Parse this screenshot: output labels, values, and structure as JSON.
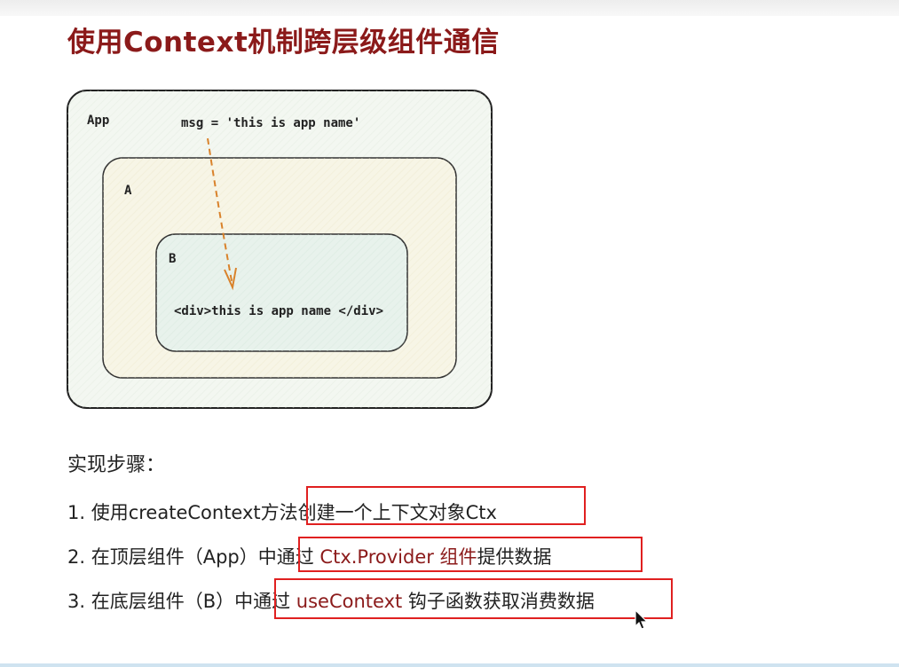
{
  "title": "使用Context机制跨层级组件通信",
  "diagram": {
    "app_label": "App",
    "msg_label": "msg = 'this is app name'",
    "a_label": "A",
    "b_label": "B",
    "b_content": "<div>this is app name </div>"
  },
  "steps": {
    "heading": "实现步骤：",
    "items": [
      {
        "prefix": "1. 使用createContext方法创建一个上下文对象Ctx",
        "highlight": "",
        "suffix": ""
      },
      {
        "prefix": "2. 在顶层组件（App）中通过 ",
        "highlight": "Ctx.Provider 组件",
        "suffix": "提供数据"
      },
      {
        "prefix": "3. 在底层组件（B）中通过 ",
        "highlight": "useContext",
        "suffix": " 钩子函数获取消费数据"
      }
    ]
  },
  "colors": {
    "title": "#8b1a1a",
    "highlight": "#8b1a1a",
    "redbox": "#e02020",
    "arrow": "#d9822b",
    "app_fill": "#f3f7f1",
    "a_fill": "#f7f5e6",
    "b_fill": "#e8f2ec"
  }
}
